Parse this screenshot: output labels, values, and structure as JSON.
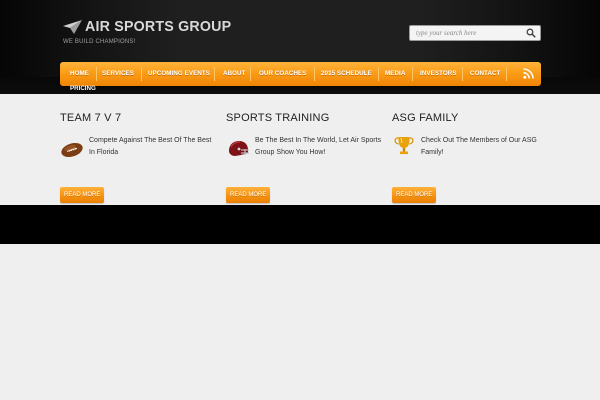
{
  "brand": {
    "name": "AIR SPORTS GROUP",
    "tagline": "WE BUILD CHAMPIONS!"
  },
  "search": {
    "placeholder": "type your search here"
  },
  "nav": {
    "items": [
      "HOME",
      "SERVICES",
      "UPCOMING EVENTS",
      "ABOUT",
      "OUR COACHES",
      "2015 SCHEDULE",
      "MEDIA",
      "INVESTORS",
      "CONTACT"
    ],
    "overflow_item": "PRICING"
  },
  "features": [
    {
      "title": "TEAM 7 V 7",
      "text": "Compete Against The Best Of The Best In Florida",
      "icon": "football-icon",
      "button": "READ MORE"
    },
    {
      "title": "SPORTS TRAINING",
      "text": "Be The Best In The World, Let Air Sports Group Show You How!",
      "icon": "helmet-icon",
      "button": "READ MORE"
    },
    {
      "title": "ASG FAMILY",
      "text": "Check Out The Members of Our ASG Family!",
      "icon": "trophy-icon",
      "button": "READ MORE"
    }
  ],
  "colors": {
    "accent": "#f7940f",
    "header_bg": "#1a1a1a",
    "body_bg": "#efefef",
    "footer_bg": "#000000"
  }
}
